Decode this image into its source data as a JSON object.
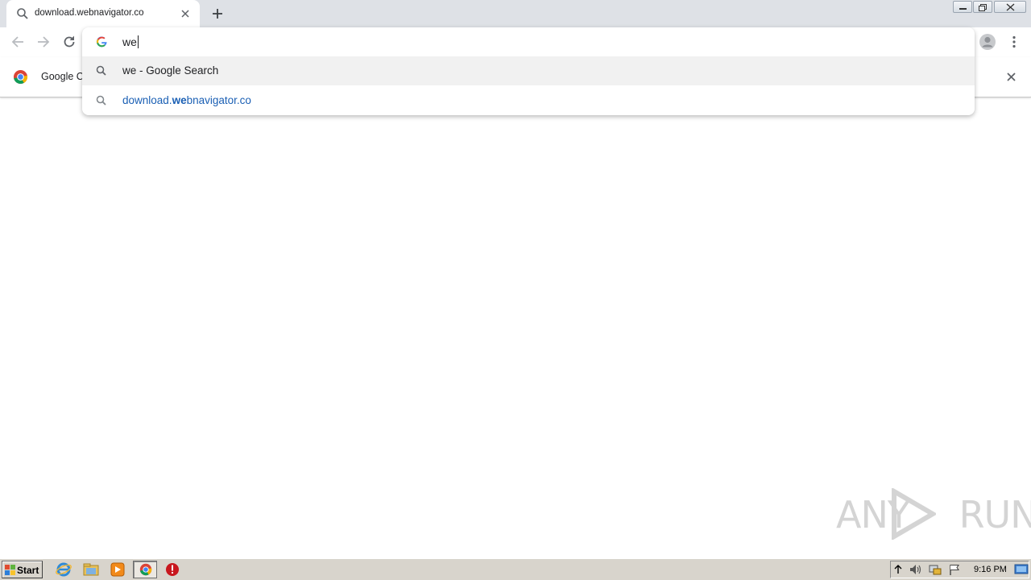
{
  "browser": {
    "tab": {
      "title": "download.webnavigator.co"
    },
    "infobar": {
      "text": "Google Cl"
    }
  },
  "omnibox": {
    "input_value": "we",
    "suggestions": [
      {
        "text": "we - Google Search",
        "type": "search",
        "highlighted": true
      },
      {
        "prefix": "download.",
        "match": "we",
        "suffix": "bnavigator.co",
        "type": "url",
        "highlighted": false
      }
    ]
  },
  "watermark": {
    "text": "ANY RUN"
  },
  "taskbar": {
    "start_label": "Start",
    "clock": "9:16 PM"
  },
  "colors": {
    "tabstrip": "#dee1e6",
    "suggestion_highlight": "#f1f1f1",
    "link_blue": "#1a5fb4",
    "taskbar": "#d8d4cc"
  }
}
